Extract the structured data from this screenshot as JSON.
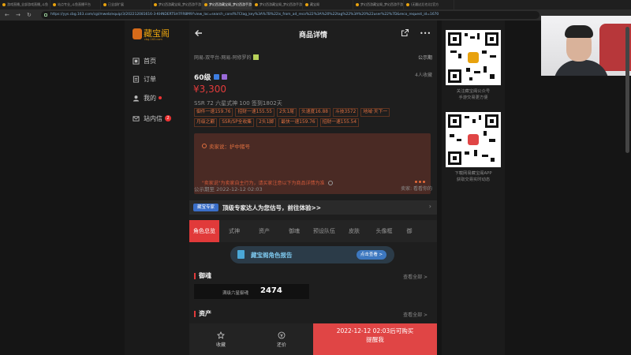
{
  "browser": {
    "tabs": [
      {
        "title": "游戏直播_全部游戏直播_斗鱼"
      },
      {
        "title": "站点专业_斗鱼直播平台"
      },
      {
        "title": "已全部扩展"
      },
      {
        "title": "梦幻西游藏宝阁_梦幻西游手游"
      },
      {
        "title": "梦幻西游藏宝阁_梦幻西游手游"
      },
      {
        "title": "梦幻西游藏宝阁_梦幻西游手游"
      },
      {
        "title": "藏宝阁"
      },
      {
        "title": "梦幻西游藏宝阁_梦幻西游手游"
      },
      {
        "title": "(无翻过后也)比官方"
      }
    ],
    "url": "https://yys.cbg.163.com/cgi/mweb/equip/3/202212081616-3-KHNDERTSH7FR8M9?view_loc=search_cond%7Ctag_key%3A%7B%22is_from_ad_reco%22%3A%20%22tag%22%3A%20%22user%22%7D&reco_request_id=1670"
  },
  "sidebar": {
    "logo_text": "藏宝阁",
    "logo_sub": "cbg.163.com",
    "items": [
      {
        "label": "首页"
      },
      {
        "label": "订单"
      },
      {
        "label": "我的"
      },
      {
        "label": "站内信",
        "badge": "2"
      }
    ]
  },
  "phone": {
    "title": "商品详情",
    "breadcrumb": "网易-双平台-网易-阿修罗的",
    "publicity_tag": "公示期",
    "level": "60级",
    "favorites": "4人收藏",
    "price": "¥3,300",
    "attributes": "SSR 72   六星式神 100   签到1802天",
    "tags": [
      "御件一速159.76",
      "招财一速155.55",
      "2头1尾",
      "头速度16.88",
      "斗技3572",
      "地域·天下一",
      "月级之巅",
      "SSR/SP全收集",
      "2头1脚",
      "最快一速159.76",
      "招财一速155.54"
    ],
    "seller_label": "卖家说：",
    "seller_title": "护中猪号",
    "seller_notice": "\"卖家说\"为卖家自主行为，请买家注意以下为商品详情为准",
    "publicity_time_label": "公示期至",
    "publicity_time": "2022-12-12 02:03",
    "seller_note": "卖家: 看看你的",
    "expert_tag": "藏宝专家",
    "expert_text": "顶级专家达人为您估号，前往体验>>",
    "tabs": [
      "角色总览",
      "式神",
      "资产",
      "御魂",
      "预设队伍",
      "皮肤",
      "头像框",
      "御"
    ],
    "report_title": "藏宝阁角色报告",
    "report_button": "点击查看 >",
    "section_yuhun": "御魂",
    "section_more": "查看全部 >",
    "yuhun_label": "满级六星御魂",
    "yuhun_value": "2474",
    "section_assets": "资产",
    "section_assets_more": "查看全部 >",
    "footer": {
      "favorite": "收藏",
      "bargain": "还价",
      "buy_time": "2022-12-12 02:03后可购买",
      "buy_sub": "提醒我"
    }
  },
  "qr": {
    "caption1a": "关注藏宝阁公众号",
    "caption1b": "手游交易更方便",
    "caption2a": "下载网易藏宝阁APP",
    "caption2b": "获取交易实时动态"
  },
  "colors": {
    "accent": "#e13a3a",
    "brand": "#e8a20e"
  }
}
